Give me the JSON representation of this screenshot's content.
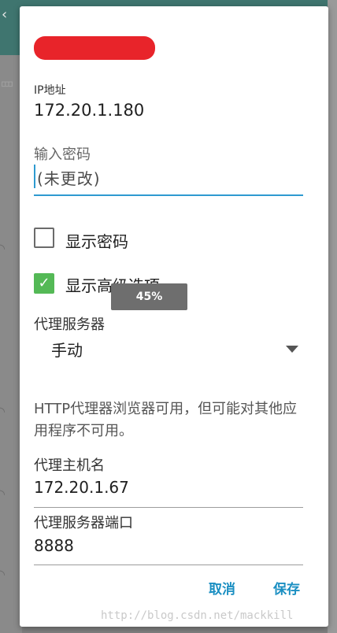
{
  "dialog": {
    "ip_label": "IP地址",
    "ip_value": "172.20.1.180",
    "password_label": "输入密码",
    "password_placeholder": "(未更改)",
    "show_password_label": "显示密码",
    "show_password_checked": false,
    "advanced_label": "显示高级选项",
    "advanced_checked": true,
    "proxy_label": "代理服务器",
    "proxy_selected": "手动",
    "proxy_note": "HTTP代理器浏览器可用，但可能对其他应用程序不可用。",
    "proxy_host_label": "代理主机名",
    "proxy_host_value": "172.20.1.67",
    "proxy_port_label": "代理服务器端口",
    "proxy_port_value": "8888",
    "cancel_label": "取消",
    "save_label": "保存"
  },
  "toast": {
    "text": "45%"
  },
  "watermark": {
    "text": "http://blog.csdn.net/mackkill"
  },
  "colors": {
    "accent": "#1b8fc2",
    "check_green": "#54b956",
    "redaction": "#e8242a"
  }
}
